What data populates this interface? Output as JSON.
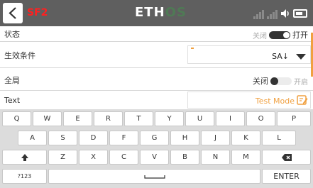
{
  "header": {
    "title": "SF2",
    "brand_main": "ETH",
    "brand_accent": "OS"
  },
  "rows": {
    "state": {
      "label": "状态",
      "off": "关闭",
      "on": "打开",
      "value": "on"
    },
    "condition": {
      "label": "生效条件",
      "value": "SA↓"
    },
    "global": {
      "label": "全局",
      "off": "关闭",
      "on": "开启",
      "value": "off"
    },
    "text": {
      "label": "Text",
      "value": "Test Mode"
    }
  },
  "keyboard": {
    "row1": [
      "Q",
      "W",
      "E",
      "R",
      "T",
      "Y",
      "U",
      "I",
      "O",
      "P"
    ],
    "row2": [
      "A",
      "S",
      "D",
      "F",
      "G",
      "H",
      "J",
      "K",
      "L"
    ],
    "row3": [
      "Z",
      "X",
      "C",
      "V",
      "B",
      "N",
      "M"
    ],
    "numbers": "?123",
    "enter": "ENTER"
  },
  "icons": {
    "back": "chevron-left-icon",
    "signal": "signal-bars-icon",
    "speaker": "speaker-icon",
    "battery": "battery-icon",
    "edit": "edit-icon",
    "shift": "shift-icon",
    "space": "space-icon",
    "backspace": "backspace-icon"
  },
  "colors": {
    "header_bg": "#5f5f5f",
    "title": "#ff2020",
    "accent": "#f0a040",
    "brand_os": "#4f7a55"
  }
}
